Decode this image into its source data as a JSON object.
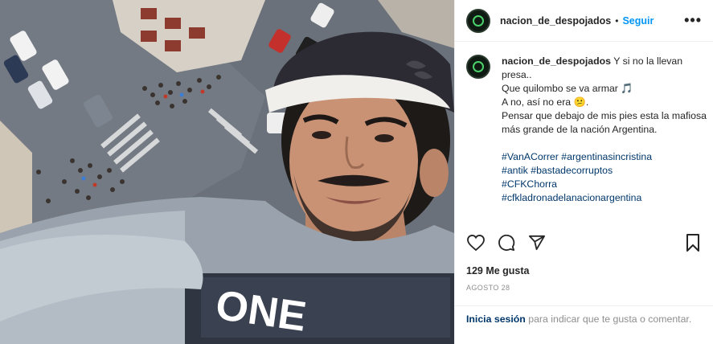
{
  "post": {
    "username": "nacion_de_despojados",
    "separator": "•",
    "follow_label": "Seguir",
    "more_label": "•••",
    "caption_lines": [
      "Y si no la llevan presa..",
      "Que quilombo se va armar 🎵",
      "A no, así no era 😕.",
      "Pensar que debajo de mis pies esta la mafiosa más grande de la nación Argentina."
    ],
    "hashtags": [
      "#VanACorrer",
      "#argentinasincristina",
      "#antik",
      "#bastadecorruptos",
      "#CFKChorra",
      "#cfkladronadelanacionargentina"
    ],
    "likes": "129 Me gusta",
    "date": "AGOSTO 28",
    "login_link": "Inicia sesión",
    "login_text": "para indicar que te gusta o comentar."
  },
  "photo": {
    "sweater_text": "ONE"
  },
  "icons": {
    "like": "heart-icon",
    "comment": "comment-icon",
    "share": "share-icon",
    "save": "bookmark-icon"
  },
  "colors": {
    "follow": "#0095f6",
    "hashtag": "#00376b",
    "text": "#262626",
    "muted": "#8e8e8e"
  }
}
